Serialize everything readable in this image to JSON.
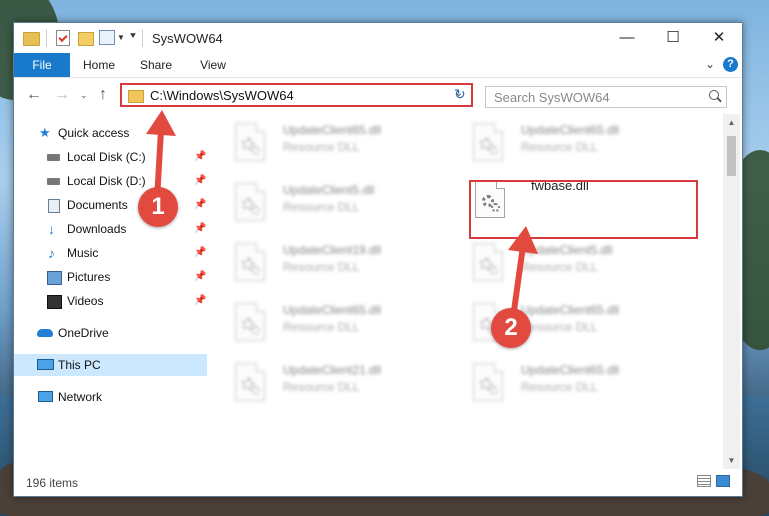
{
  "window": {
    "title": "SysWOW64",
    "controls": {
      "minimize": "—",
      "maximize": "☐",
      "close": "✕"
    },
    "quick_access_toolbar": [
      "folder-icon",
      "properties-check-icon",
      "new-folder-icon",
      "properties-icon",
      "chevron-down-icon",
      "pin-icon"
    ]
  },
  "ribbon": {
    "tabs": [
      "File",
      "Home",
      "Share",
      "View"
    ],
    "help": "?"
  },
  "navigation": {
    "address": "C:\\Windows\\SysWOW64",
    "search_placeholder": "Search SysWOW64",
    "buttons": [
      "back-arrow-icon",
      "forward-arrow-icon",
      "recent-dropdown-icon",
      "up-arrow-icon",
      "refresh-icon"
    ]
  },
  "sidebar": {
    "items": [
      {
        "label": "Quick access",
        "icon": "star-icon"
      },
      {
        "label": "Local Disk (C:)",
        "icon": "disk-icon",
        "pinned": true
      },
      {
        "label": "Local Disk (D:)",
        "icon": "disk-icon",
        "pinned": true
      },
      {
        "label": "Documents",
        "icon": "documents-icon",
        "pinned": true
      },
      {
        "label": "Downloads",
        "icon": "download-icon",
        "pinned": true
      },
      {
        "label": "Music",
        "icon": "music-icon",
        "pinned": true
      },
      {
        "label": "Pictures",
        "icon": "pictures-icon",
        "pinned": true
      },
      {
        "label": "Videos",
        "icon": "videos-icon",
        "pinned": true
      },
      {
        "label": "OneDrive",
        "icon": "cloud-icon"
      },
      {
        "label": "This PC",
        "icon": "pc-icon",
        "selected": true
      },
      {
        "label": "Network",
        "icon": "network-icon"
      }
    ]
  },
  "files": [
    {
      "name": "UpdateClient65.dll",
      "type": "Resource DLL",
      "blurred": true
    },
    {
      "name": "UpdateClient65.dll",
      "type": "Resource DLL",
      "blurred": true
    },
    {
      "name": "UpdateClient5.dll",
      "type": "Resource DLL",
      "blurred": true
    },
    {
      "name": "fwbase.dll",
      "type": "",
      "blurred": false,
      "highlighted": true
    },
    {
      "name": "UpdateClient19.dll",
      "type": "Resource DLL",
      "blurred": true
    },
    {
      "name": "UpdateClient5.dll",
      "type": "Resource DLL",
      "blurred": true
    },
    {
      "name": "UpdateClient65.dll",
      "type": "Resource DLL",
      "blurred": true
    },
    {
      "name": "UpdateClient65.dll",
      "type": "Resource DLL",
      "blurred": true
    },
    {
      "name": "UpdateClient21.dll",
      "type": "Resource DLL",
      "blurred": true
    },
    {
      "name": "UpdateClient65.dll",
      "type": "Resource DLL",
      "blurred": true
    }
  ],
  "status": {
    "item_count": "196 items"
  },
  "callouts": [
    {
      "number": "1"
    },
    {
      "number": "2"
    }
  ],
  "colors": {
    "accent": "#1979ca",
    "highlight": "#d8393b",
    "callout": "#e24a3f",
    "selection": "#cce8ff"
  }
}
